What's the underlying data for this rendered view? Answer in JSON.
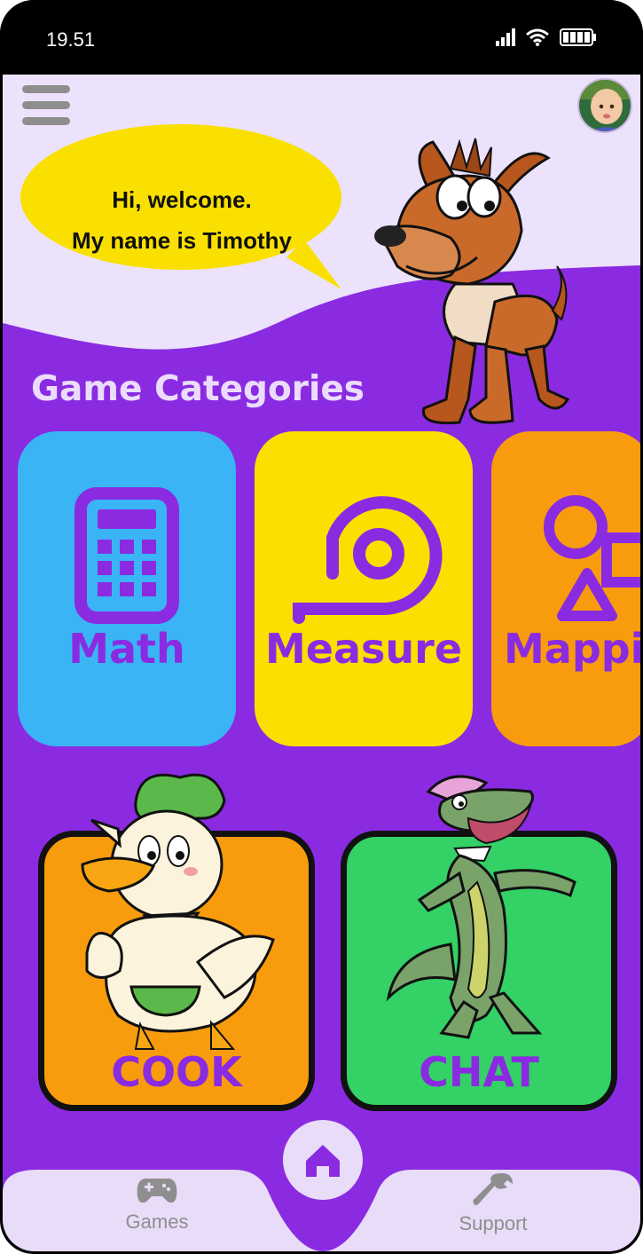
{
  "status": {
    "time": "19.51"
  },
  "header": {
    "greeting_line1": "Hi, welcome.",
    "greeting_line2": "My name is Timothy"
  },
  "categories": {
    "title": "Game Categories",
    "items": [
      {
        "label": "Math",
        "color": "#3ab4f5",
        "icon": "calculator-icon"
      },
      {
        "label": "Measure",
        "color": "#f9e000",
        "icon": "tape-measure-icon"
      },
      {
        "label": "Mappi",
        "color": "#f89c0e",
        "icon": "shapes-icon"
      }
    ]
  },
  "activities": [
    {
      "label": "COOK",
      "color": "#f89c0e",
      "mascot": "duck-chef"
    },
    {
      "label": "CHAT",
      "color": "#33d166",
      "mascot": "crocodile"
    }
  ],
  "nav": {
    "games": "Games",
    "home": "Home",
    "support": "Support"
  },
  "colors": {
    "primary": "#8a2be2",
    "background_light": "#ece2fb",
    "bubble": "#f9e000"
  }
}
